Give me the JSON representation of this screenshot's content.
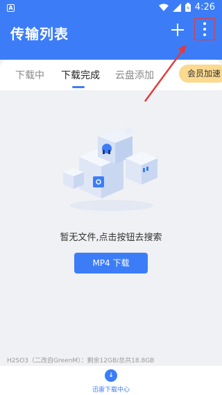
{
  "statusbar": {
    "left_badge": "A",
    "time": "4:26"
  },
  "header": {
    "title": "传输列表"
  },
  "tabs": [
    {
      "label": "下载中"
    },
    {
      "label": "下载完成"
    },
    {
      "label": "云盘添加"
    }
  ],
  "vip_button": {
    "label": "会员加速"
  },
  "empty_state": {
    "message": "暂无文件,点击按钮去搜索",
    "button_label": "MP4 下载"
  },
  "storage_info": "H2SO3（二改自GreenM）：剩余12GB/总共18.8GB",
  "bottom_nav": {
    "label": "迅雷下载中心",
    "icon_text": "↓"
  },
  "colors": {
    "primary": "#3c7df7",
    "vip": "#fbd98f",
    "annotation": "#e23b3b"
  }
}
